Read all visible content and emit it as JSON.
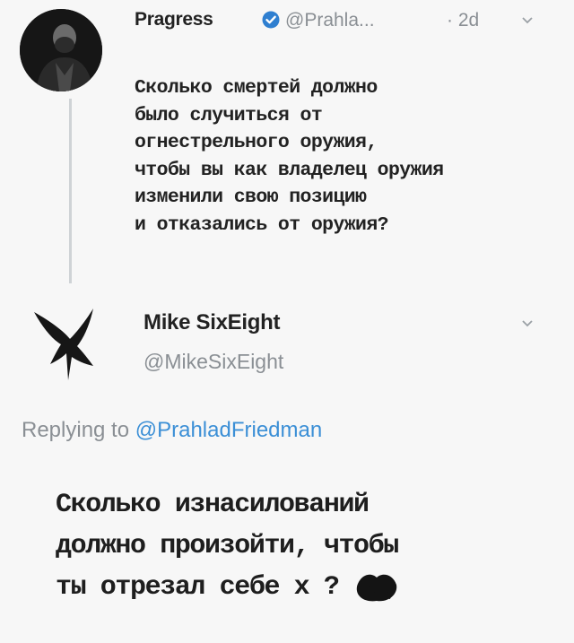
{
  "tweet1": {
    "display_name": "Pragress",
    "handle": "@Prahla...",
    "time": "2d",
    "text": "Сколько смертей должно\nбыло случиться от\nогнестрельного оружия,\nчтобы вы как владелец оружия\nизменили свою позицию\nи отказались от оружия?"
  },
  "tweet2": {
    "display_name": "Mike SixEight",
    "handle": "@MikeSixEight",
    "replying_prefix": "Replying to ",
    "replying_mention": "@PrahladFriedman",
    "text": "Сколько изнасилований\nдолжно произойти, чтобы\nты отрезал себе х  ?"
  },
  "icons": {
    "verified": "verified-badge-icon",
    "menu": "chevron-down-icon",
    "avatar2": "bird-silhouette-icon",
    "censor": "censor-scribble-icon"
  },
  "colors": {
    "muted_text": "#8a8f94",
    "mention": "#3b8fd6",
    "verified": "#2f7fd0"
  }
}
